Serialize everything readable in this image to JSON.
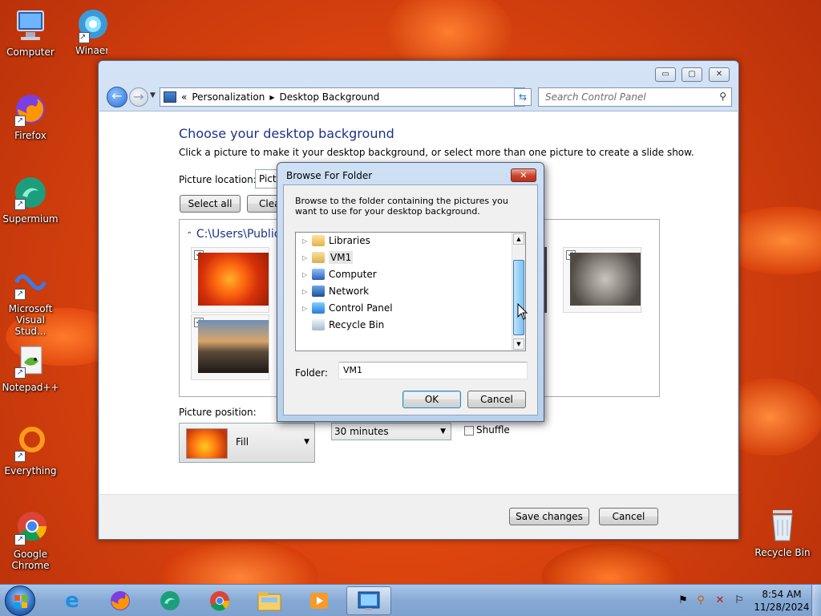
{
  "desktop": {
    "icons": [
      {
        "label": "Computer",
        "icon": "computer-icon"
      },
      {
        "label": "Winaero Twea",
        "icon": "winaero-tweaker-icon"
      },
      {
        "label": "Firefox",
        "icon": "firefox-icon"
      },
      {
        "label": "Supermium",
        "icon": "supermium-icon"
      },
      {
        "label": "Microsoft Visual Stud...",
        "icon": "visual-studio-icon"
      },
      {
        "label": "Notepad++",
        "icon": "notepadpp-icon"
      },
      {
        "label": "Everything",
        "icon": "everything-icon"
      },
      {
        "label": "Google Chrome",
        "icon": "chrome-icon"
      },
      {
        "label": "Recycle Bin",
        "icon": "recycle-bin-icon"
      }
    ]
  },
  "window": {
    "breadcrumb": {
      "prefix": "«",
      "items": [
        "Personalization",
        "Desktop Background"
      ]
    },
    "search_placeholder": "Search Control Panel",
    "heading": "Choose your desktop background",
    "subheading": "Click a picture to make it your desktop background, or select more than one picture to create a slide show.",
    "picture_location_label": "Picture location:",
    "picture_location_value": "Pictu",
    "select_all": "Select all",
    "clear_all": "Clea",
    "folder_path": "C:\\Users\\Public\\",
    "picture_position_label": "Picture position:",
    "picture_position_value": "Fill",
    "interval_value": "30 minutes",
    "shuffle_label": "Shuffle",
    "save_changes": "Save changes",
    "cancel": "Cancel"
  },
  "dialog": {
    "title": "Browse For Folder",
    "description": "Browse to the folder containing the pictures you want to use for your desktop background.",
    "tree": [
      {
        "label": "Libraries",
        "icon": "libraries-icon",
        "expandable": true
      },
      {
        "label": "VM1",
        "icon": "user-folder-icon",
        "expandable": true,
        "selected": true
      },
      {
        "label": "Computer",
        "icon": "computer-icon",
        "expandable": true
      },
      {
        "label": "Network",
        "icon": "network-icon",
        "expandable": true
      },
      {
        "label": "Control Panel",
        "icon": "control-panel-icon",
        "expandable": true
      },
      {
        "label": "Recycle Bin",
        "icon": "recycle-bin-icon",
        "expandable": false
      }
    ],
    "folder_label": "Folder:",
    "folder_value": "VM1",
    "ok": "OK",
    "cancel": "Cancel"
  },
  "taskbar": {
    "apps": [
      "ie-icon",
      "firefox-icon",
      "supermium-icon",
      "chrome-icon",
      "explorer-icon",
      "media-player-icon",
      "control-panel-icon"
    ],
    "time": "8:54 AM",
    "date": "11/28/2024"
  }
}
